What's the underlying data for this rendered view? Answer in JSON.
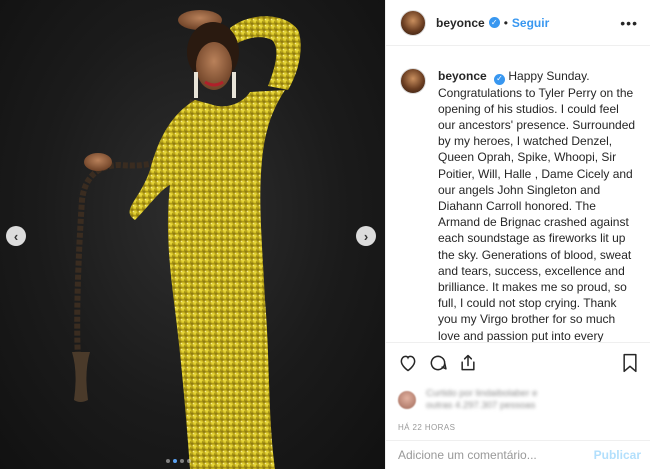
{
  "post": {
    "username": "beyonce",
    "follow_label": "Seguir",
    "bullet": "•",
    "more_icon": "more-horizontal-icon",
    "caption_text": "Happy Sunday. Congratulations to Tyler Perry on the opening of his studios. I could feel our ancestors' presence. Surrounded by my heroes, I watched Denzel, Queen Oprah, Spike, Whoopi, Sir Poitier, Will, Halle , Dame Cicely and our angels John Singleton and Diahann Carroll honored. The Armand de Brignac crashed against each soundstage as fireworks lit up the sky. Generations of blood, sweat and tears, success, excellence and brilliance. It makes me so proud, so full, I could not stop crying. Thank you my Virgo brother for so much love and passion put into every detail. My prayer today is that you will take it all in. You inspire me to dream even bigger.",
    "likes_text_line1": "Curtido por lindaibolaber e",
    "likes_text_line2": "outras 4.297.307 pessoas",
    "time_label": "HÁ 22 HORAS",
    "comment_placeholder": "Adicione um comentário...",
    "publish_label": "Publicar"
  },
  "media": {
    "prev_arrow": "‹",
    "next_arrow": "›",
    "carousel_dots": 4,
    "active_dot": 1
  },
  "colors": {
    "accent": "#3897f0",
    "publish_disabled": "#b2dffc",
    "dress_gold": "#d8c62a",
    "background_dark": "#1b1b1b"
  }
}
